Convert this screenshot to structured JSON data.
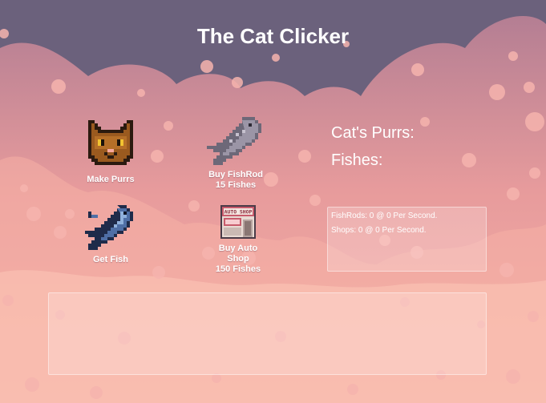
{
  "title": "The Cat Clicker",
  "buttons": {
    "make_purrs": {
      "label": "Make Purrs",
      "icon": "cat-face-icon"
    },
    "get_fish": {
      "label": "Get Fish",
      "icon": "fish-icon"
    },
    "buy_fishrod": {
      "label_line1": "Buy FishRod",
      "label_line2": "15 Fishes",
      "icon": "grey-fish-icon"
    },
    "buy_auto_shop": {
      "label_line1": "Buy Auto",
      "label_line2": "Shop",
      "label_line3": "150 Fishes",
      "icon": "shop-icon",
      "shop_sign": "AUTO SHOP"
    }
  },
  "stats": {
    "purrs_label": "Cat's Purrs:",
    "fishes_label": "Fishes:"
  },
  "rates": {
    "fishrods": "FishRods: 0 @ 0 Per Second.",
    "shops": "Shops: 0 @ 0 Per Second."
  },
  "colors": {
    "sky": "#6b617c",
    "cloud": "#f2a39f",
    "text": "#ffffff"
  }
}
